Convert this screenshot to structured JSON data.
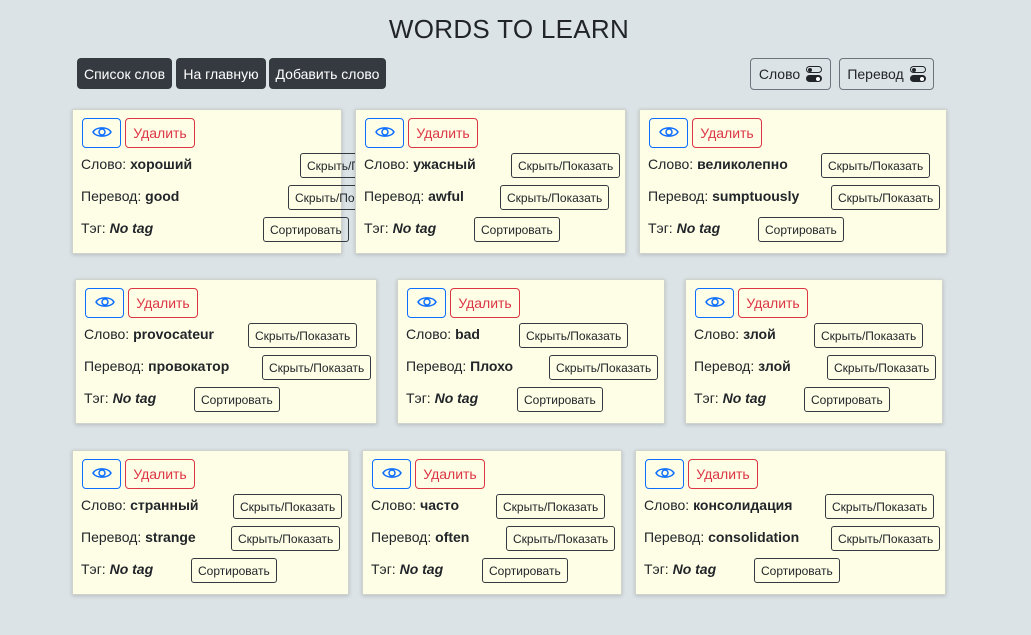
{
  "header": {
    "title": "WORDS TO LEARN"
  },
  "nav": {
    "word_list": "Список слов",
    "home": "На главную",
    "add_word": "Добавить слово",
    "toggle_word": "Слово",
    "toggle_translation": "Перевод"
  },
  "labels": {
    "word": "Слово:",
    "translation": "Перевод:",
    "tag": "Тэг:",
    "delete": "Удалить",
    "hide_show": "Скрыть/Показать",
    "sort": "Сортировать"
  },
  "cards": [
    {
      "word": "хороший",
      "translation": "good",
      "tag": "No tag"
    },
    {
      "word": "ужасный",
      "translation": "awful",
      "tag": "No tag"
    },
    {
      "word": "великолепно",
      "translation": "sumptuously",
      "tag": "No tag"
    },
    {
      "word": "provocateur",
      "translation": "провокатор",
      "tag": "No tag"
    },
    {
      "word": "bad",
      "translation": "Плохо",
      "tag": "No tag"
    },
    {
      "word": "злой",
      "translation": "злой",
      "tag": "No tag"
    },
    {
      "word": "странный",
      "translation": "strange",
      "tag": "No tag"
    },
    {
      "word": "часто",
      "translation": "often",
      "tag": "No tag"
    },
    {
      "word": "консолидация",
      "translation": "consolidation",
      "tag": "No tag"
    }
  ],
  "colors": {
    "background": "#dce3e6",
    "card": "#fefee6",
    "nav_button": "#343a40",
    "eye_button": "#0d6efd",
    "delete_button": "#dc3545"
  },
  "icons": {
    "eye": "eye-icon",
    "toggle": "toggle-icon"
  }
}
